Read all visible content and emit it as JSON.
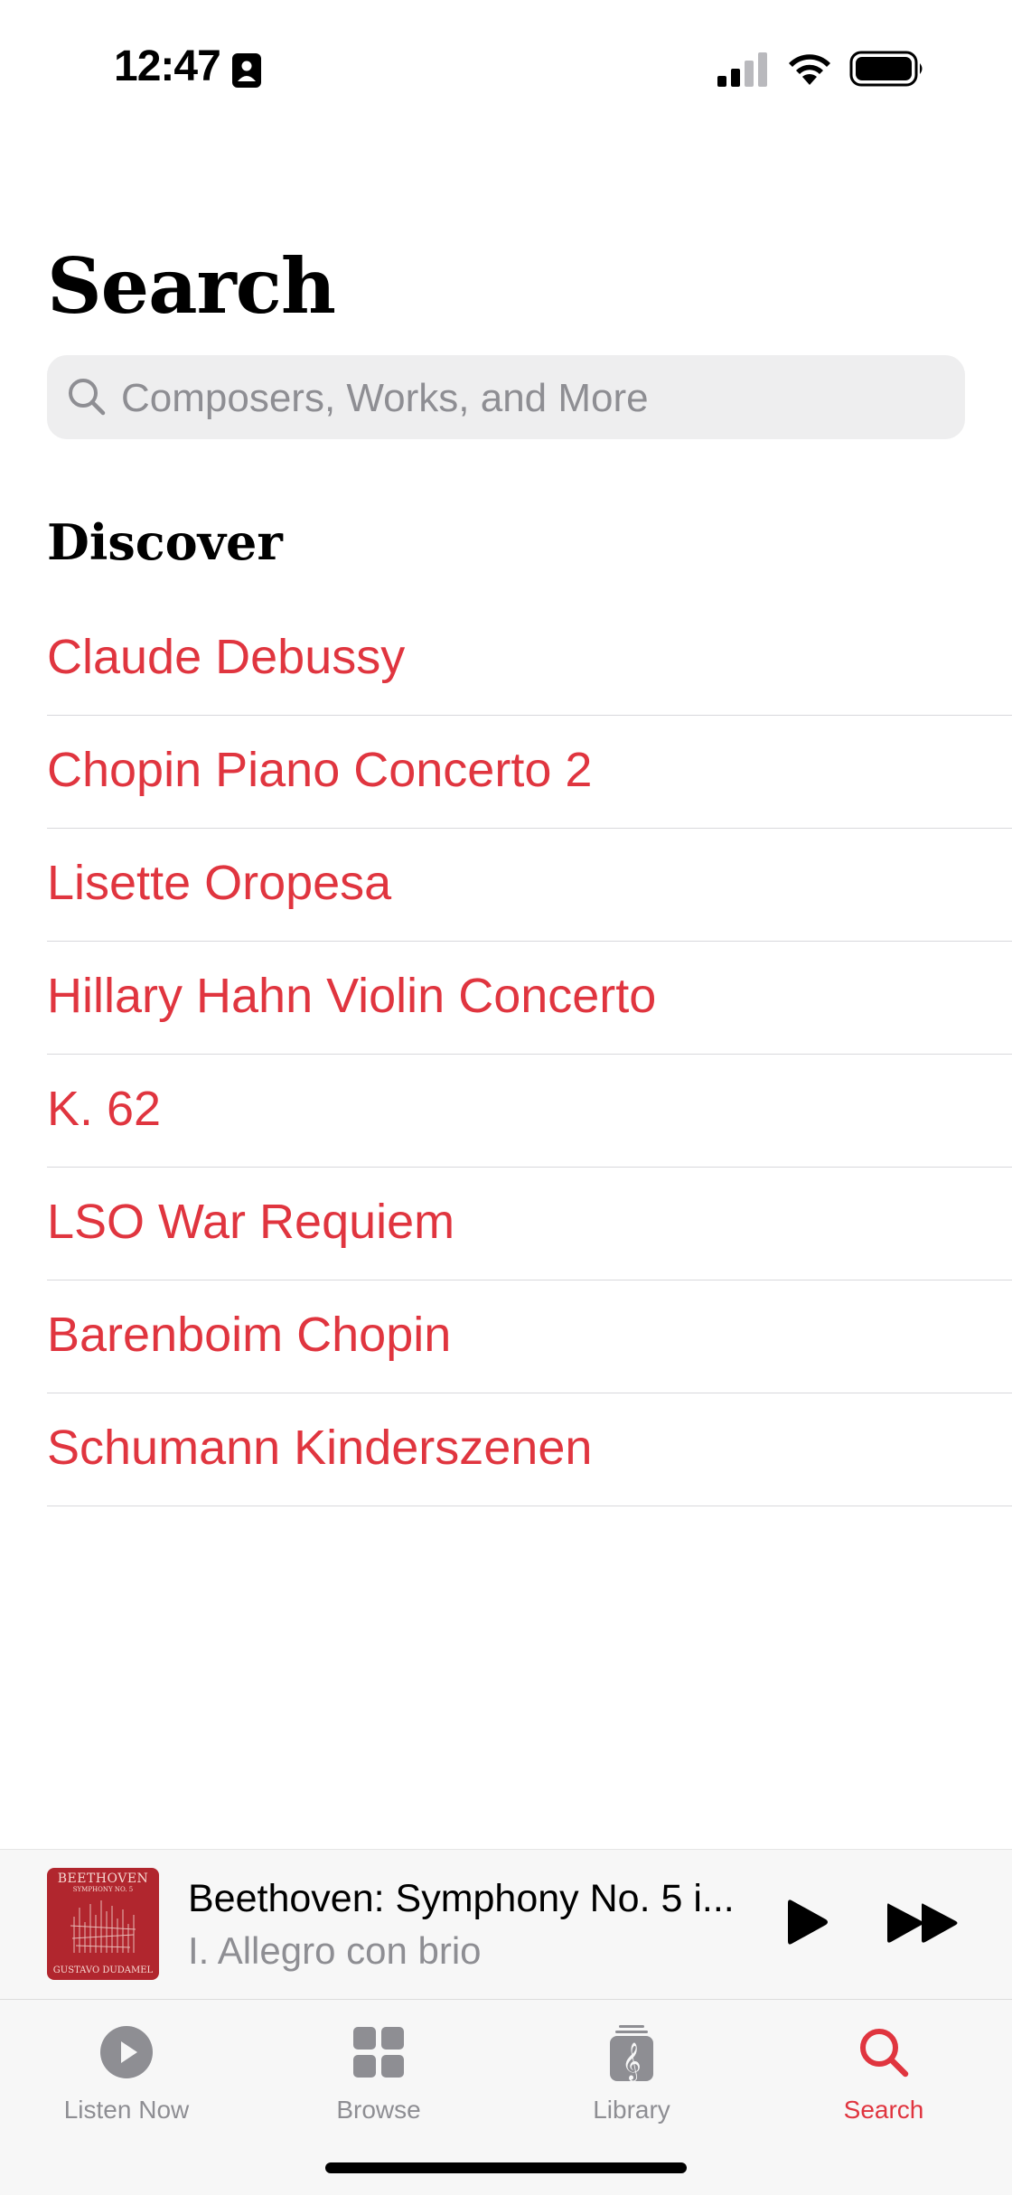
{
  "status_bar": {
    "time": "12:47"
  },
  "header": {
    "title": "Search"
  },
  "search": {
    "placeholder": "Composers, Works, and More"
  },
  "discover": {
    "title": "Discover",
    "items": [
      "Claude Debussy",
      "Chopin Piano Concerto 2",
      "Lisette Oropesa",
      "Hillary Hahn Violin Concerto",
      "K. 62",
      "LSO War Requiem",
      "Barenboim Chopin",
      "Schumann Kinderszenen"
    ]
  },
  "now_playing": {
    "title": "Beethoven: Symphony No. 5 i...",
    "subtitle": "I. Allegro con brio",
    "art_text": {
      "top": "BEETHOVEN",
      "line2": "SYMPHONY NO. 5",
      "bottom": "GUSTAVO DUDAMEL"
    }
  },
  "tabs": [
    {
      "label": "Listen Now",
      "icon": "play-circle-icon",
      "active": false
    },
    {
      "label": "Browse",
      "icon": "grid-icon",
      "active": false
    },
    {
      "label": "Library",
      "icon": "music-library-icon",
      "active": false
    },
    {
      "label": "Search",
      "icon": "search-icon",
      "active": true
    }
  ],
  "colors": {
    "accent": "#e0353f",
    "secondary_text": "#8e8e93",
    "search_field_bg": "#eeeeef"
  }
}
